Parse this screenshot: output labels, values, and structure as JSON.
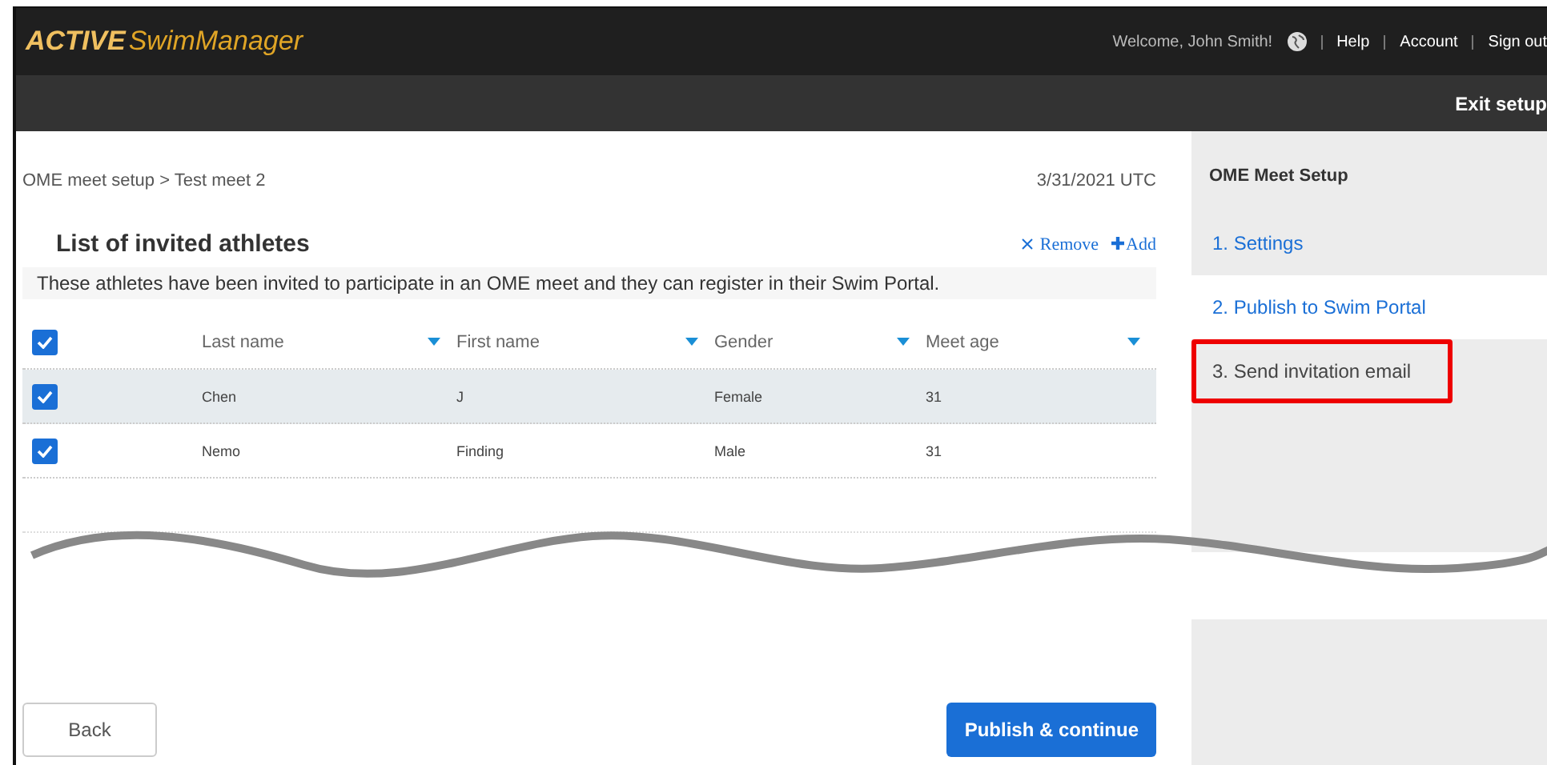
{
  "header": {
    "logo_bold": "ACTIVE",
    "logo_light": "SwimManager",
    "welcome": "Welcome, John Smith!",
    "links": [
      "Help",
      "Account",
      "Sign out"
    ]
  },
  "subheader": {
    "action": "Exit setup"
  },
  "breadcrumb": "OME meet setup > Test meet 2",
  "date": "3/31/2021 UTC",
  "section": {
    "title": "List of invited athletes",
    "remove": "Remove",
    "add": "Add",
    "description": "These athletes have been invited to participate in an OME meet and they can register in their Swim Portal."
  },
  "table": {
    "all_checked": true,
    "columns": [
      "Last name",
      "First name",
      "Gender",
      "Meet age"
    ],
    "rows": [
      {
        "checked": true,
        "selected": true,
        "cells": [
          "Chen",
          "J",
          "Female",
          "31"
        ]
      },
      {
        "checked": true,
        "selected": false,
        "cells": [
          "Nemo",
          "Finding",
          "Male",
          "31"
        ]
      }
    ]
  },
  "buttons": {
    "back": "Back",
    "primary": "Publish & continue"
  },
  "sidebar": {
    "title": "OME Meet Setup",
    "steps": [
      {
        "label": "1. Settings",
        "selected": false,
        "highlighted": false
      },
      {
        "label": "2. Publish to Swim Portal",
        "selected": true,
        "highlighted": false
      },
      {
        "label": "3. Send invitation email",
        "selected": false,
        "highlighted": true
      }
    ]
  }
}
